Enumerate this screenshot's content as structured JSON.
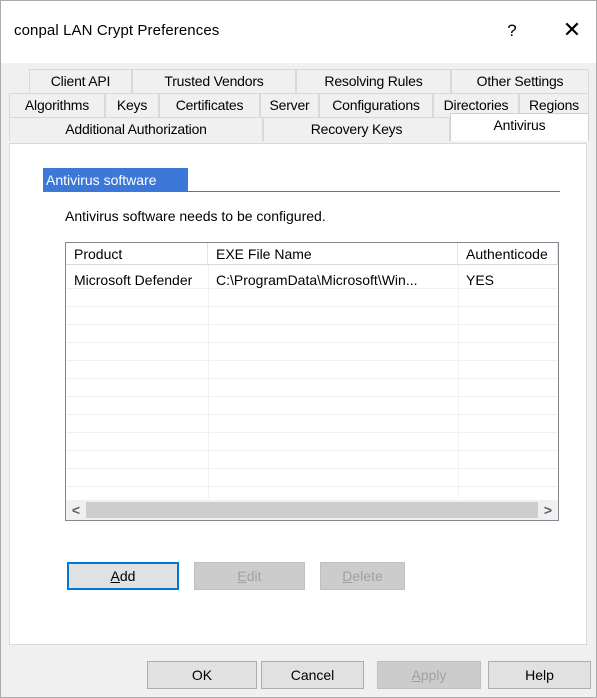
{
  "window": {
    "title": "conpal LAN Crypt Preferences",
    "help_glyph": "?",
    "close_glyph": "✕"
  },
  "tabs": {
    "row1": [
      "Client API",
      "Trusted Vendors",
      "Resolving Rules",
      "Other Settings"
    ],
    "row2": [
      "Algorithms",
      "Keys",
      "Certificates",
      "Server",
      "Configurations",
      "Directories",
      "Regions"
    ],
    "row3": [
      "Additional Authorization",
      "Recovery Keys",
      "Antivirus"
    ],
    "active": "Antivirus"
  },
  "section": {
    "header": "Antivirus software",
    "info": "Antivirus software needs to be configured."
  },
  "list": {
    "columns": [
      "Product",
      "EXE File Name",
      "Authenticode"
    ],
    "rows": [
      [
        "Microsoft Defender",
        "C:\\ProgramData\\Microsoft\\Win...",
        "YES"
      ]
    ],
    "scroll_left": "<",
    "scroll_right": ">"
  },
  "buttons": {
    "add": {
      "ul": "A",
      "rest": "dd"
    },
    "edit": {
      "ul": "E",
      "rest": "dit"
    },
    "delete": {
      "ul": "D",
      "rest": "elete"
    }
  },
  "footer": {
    "ok": "OK",
    "cancel": "Cancel",
    "apply_ul": "A",
    "apply_rest": "pply",
    "help": "Help"
  },
  "colors": {
    "accent": "#3c78d8",
    "default_button_border": "#0078d7"
  }
}
